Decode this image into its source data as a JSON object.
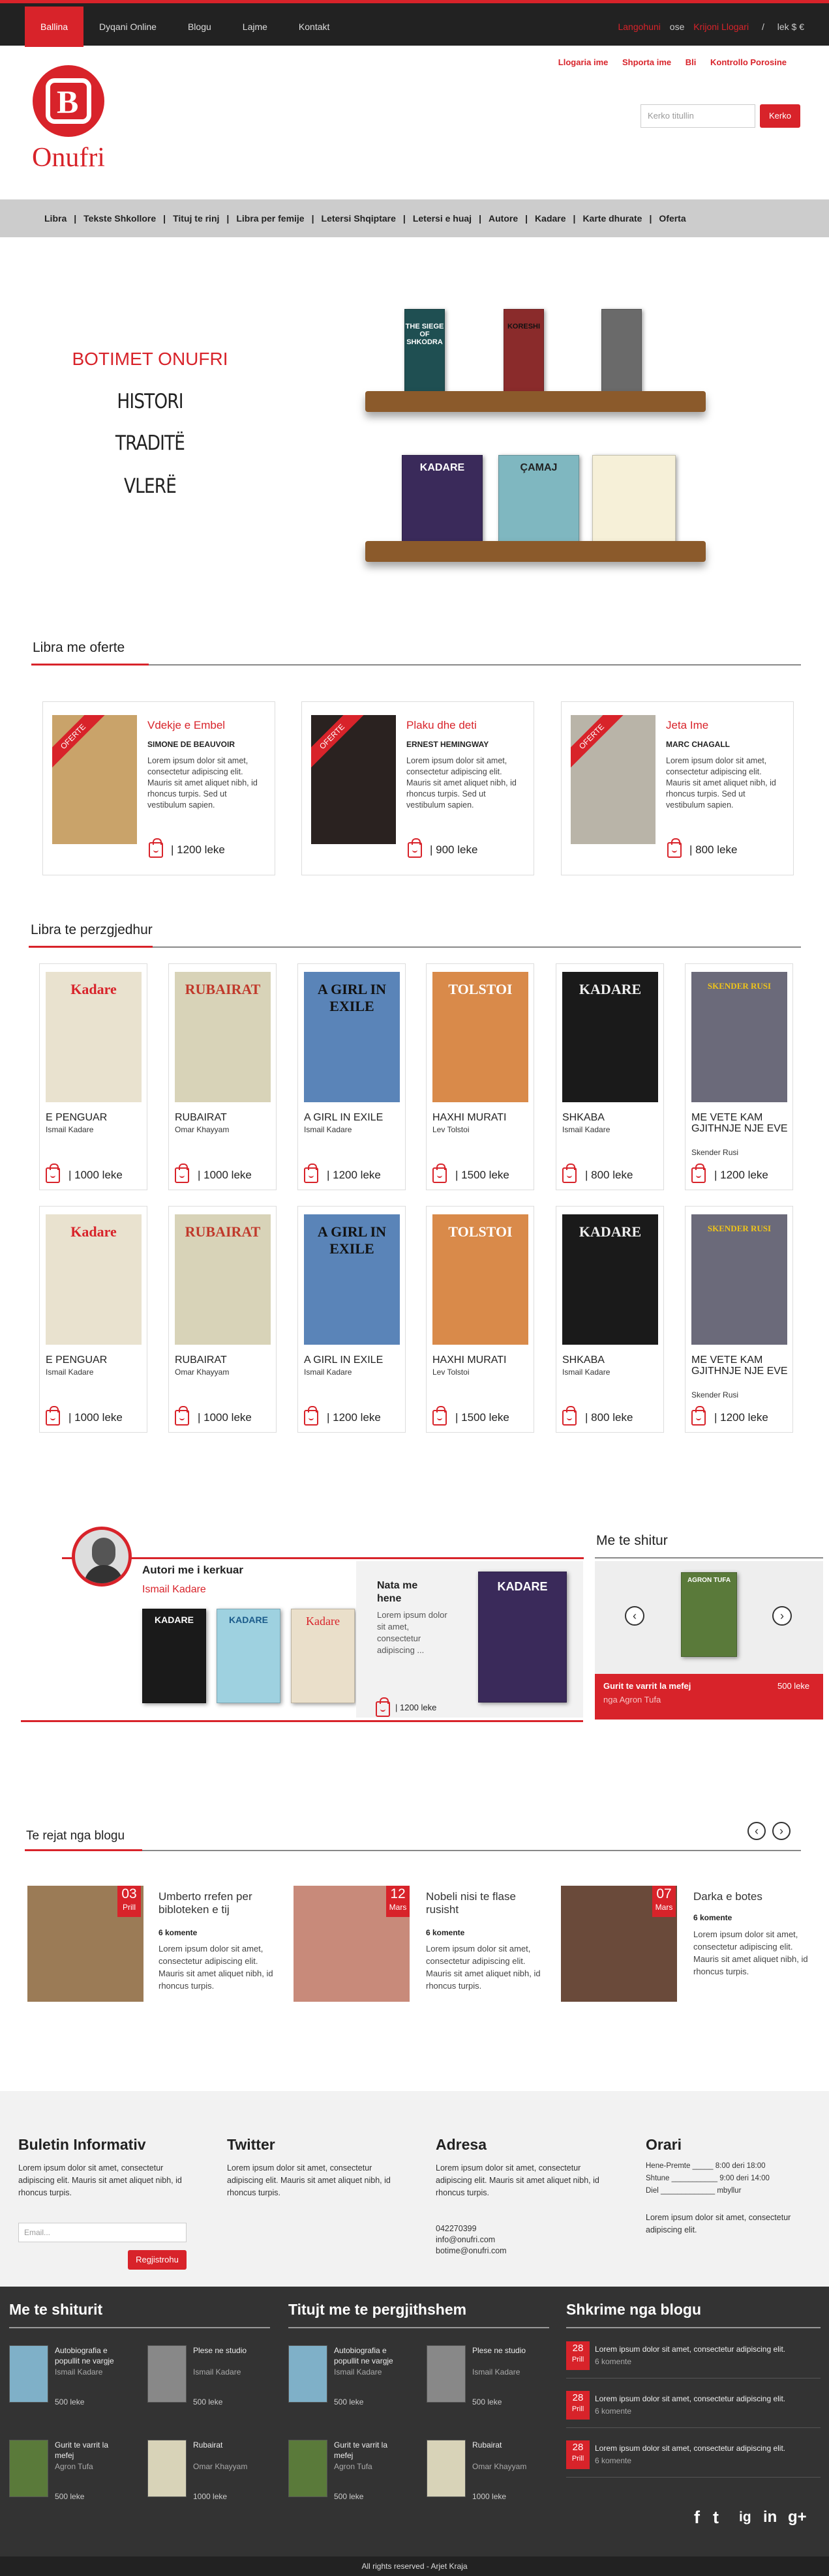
{
  "topbar": {
    "nav": [
      "Ballina",
      "Dyqani Online",
      "Blogu",
      "Lajme",
      "Kontakt"
    ],
    "login": "Langohuni",
    "or": "ose",
    "register": "Krijoni Llogari",
    "sep": "/",
    "currency": "lek $ €"
  },
  "header": {
    "logo_text": "Onufri",
    "account_links": [
      "Llogaria ime",
      "Shporta ime",
      "Bli",
      "Kontrollo Porosine"
    ],
    "search_placeholder": "Kerko titullin",
    "search_button": "Kerko"
  },
  "categories": [
    "Libra",
    "Tekste Shkollore",
    "Tituj te rinj",
    "Libra per femije",
    "Letersi Shqiptare",
    "Letersi e huaj",
    "Autore",
    "Kadare",
    "Karte dhurate",
    "Oferta"
  ],
  "hero": {
    "title": "BOTIMET ONUFRI",
    "words": [
      "HISTORI",
      "TRADITË",
      "VLERË"
    ],
    "books": [
      "THE SIEGE OF SHKODRA",
      "KORESHI",
      "",
      "KADARE",
      "ÇAMAJ",
      ""
    ]
  },
  "offers": {
    "heading": "Libra me oferte",
    "ribbon": "OFERTE",
    "items": [
      {
        "title": "Vdekje e Embel",
        "author": "SIMONE DE BEAUVOIR",
        "desc": "Lorem ipsum dolor sit amet, consectetur adipiscing elit. Mauris sit amet aliquet nibh, id rhoncus turpis. Sed ut vestibulum sapien.",
        "price": "| 1200 leke",
        "cover": "#c9a36a"
      },
      {
        "title": "Plaku dhe deti",
        "author": "ERNEST HEMINGWAY",
        "desc": "Lorem ipsum dolor sit amet, consectetur adipiscing elit. Mauris sit amet aliquet nibh, id rhoncus turpis. Sed ut vestibulum sapien.",
        "price": "| 900 leke",
        "cover": "#2a2220"
      },
      {
        "title": "Jeta Ime",
        "author": "MARC CHAGALL",
        "desc": "Lorem ipsum dolor sit amet, consectetur adipiscing elit. Mauris sit amet aliquet nibh, id rhoncus turpis. Sed ut vestibulum sapien.",
        "price": "| 800 leke",
        "cover": "#b9b4a8"
      }
    ]
  },
  "featured": {
    "heading": "Libra te perzgjedhur",
    "items": [
      {
        "title": "E PENGUAR",
        "author": "Ismail Kadare",
        "price": "| 1000 leke",
        "cover_label": "Kadare",
        "bg": "#e9e2cf",
        "fg": "#d8232a"
      },
      {
        "title": "RUBAIRAT",
        "author": "Omar Khayyam",
        "price": "| 1000 leke",
        "cover_label": "RUBAIRAT",
        "bg": "#d8d3b8",
        "fg": "#c0392b"
      },
      {
        "title": "A GIRL IN EXILE",
        "author": "Ismail Kadare",
        "price": "| 1200 leke",
        "cover_label": "A GIRL IN EXILE",
        "bg": "#5a84b8",
        "fg": "#111"
      },
      {
        "title": "HAXHI MURATI",
        "author": "Lev Tolstoi",
        "price": "| 1500 leke",
        "cover_label": "TOLSTOI",
        "bg": "#d98a4a",
        "fg": "#fff"
      },
      {
        "title": "SHKABA",
        "author": "Ismail Kadare",
        "price": "| 800 leke",
        "cover_label": "KADARE",
        "bg": "#1a1a1a",
        "fg": "#eee"
      },
      {
        "title": "ME VETE KAM GJITHNJE NJE EVE",
        "author": "Skender Rusi",
        "price": "| 1200 leke",
        "cover_label": "SKENDER RUSI",
        "bg": "#6b6a7a",
        "fg": "#f0c419"
      }
    ]
  },
  "author_section": {
    "heading": "Autori me i kerkuar",
    "name": "Ismail Kadare",
    "books": [
      "KADARE",
      "KADARE",
      "Kadare"
    ],
    "feature_title": "Nata me hene",
    "feature_desc": "Lorem ipsum dolor sit amet, consectetur adipiscing ...",
    "feature_price": "| 1200 leke",
    "feature_cover": "KADARE"
  },
  "popular": {
    "heading": "Me te shitur",
    "book_title": "Gurit te varrit la mefej",
    "author": "nga Agron Tufa",
    "price": "500 leke",
    "cover_label": "AGRON TUFA"
  },
  "blog": {
    "heading": "Te rejat nga blogu",
    "posts": [
      {
        "day": "03",
        "month": "Prill",
        "title": "Umberto rrefen per bibloteken e tij",
        "comments": "6 komente",
        "desc": "Lorem ipsum dolor sit amet, consectetur adipiscing elit. Mauris sit amet aliquet nibh, id rhoncus turpis."
      },
      {
        "day": "12",
        "month": "Mars",
        "title": "Nobeli nisi te flase rusisht",
        "comments": "6 komente",
        "desc": "Lorem ipsum dolor sit amet, consectetur adipiscing elit. Mauris sit amet aliquet nibh, id rhoncus turpis."
      },
      {
        "day": "07",
        "month": "Mars",
        "title": "Darka e botes",
        "comments": "6 komente",
        "desc": "Lorem ipsum dolor sit amet, consectetur adipiscing elit. Mauris sit amet aliquet nibh, id rhoncus turpis."
      }
    ]
  },
  "footer": {
    "newsletter": {
      "title": "Buletin Informativ",
      "text": "Lorem ipsum dolor sit amet, consectetur adipiscing elit. Mauris sit amet aliquet nibh, id rhoncus turpis.",
      "placeholder": "Email...",
      "button": "Regjistrohu"
    },
    "twitter": {
      "title": "Twitter",
      "text": "Lorem ipsum dolor sit amet, consectetur adipiscing elit. Mauris sit amet aliquet nibh, id rhoncus turpis."
    },
    "address": {
      "title": "Adresa",
      "text": "Lorem ipsum dolor sit amet, consectetur adipiscing elit. Mauris sit amet aliquet nibh, id rhoncus turpis.",
      "phone": "042270399",
      "email1": "info@onufri.com",
      "email2": "botime@onufri.com"
    },
    "hours": {
      "title": "Orari",
      "rows": [
        "Hene-Premte _____ 8:00 deri 18:00",
        "Shtune ___________ 9:00 deri 14:00",
        "Diel _____________ mbyllur"
      ],
      "text": "Lorem ipsum dolor sit amet, consectetur adipiscing elit."
    },
    "bestsellers": {
      "title": "Me te shiturit"
    },
    "new_titles": {
      "title": "Titujt me te pergjithshem"
    },
    "blog_subs": {
      "title": "Shkrime nga blogu"
    },
    "mini_books": [
      {
        "title": "Autobiografia e popullit ne vargje",
        "author": "Ismail Kadare",
        "price": "500 leke",
        "bg": "#7fb0c8"
      },
      {
        "title": "Plese ne studio",
        "author": "Ismail Kadare",
        "price": "500 leke",
        "bg": "#888"
      },
      {
        "title": "Gurit te varrit la mefej",
        "author": "Agron Tufa",
        "price": "500 leke",
        "bg": "#5a7a3a"
      },
      {
        "title": "Rubairat",
        "author": "Omar Khayyam",
        "price": "1000 leke",
        "bg": "#d8d3b8"
      }
    ],
    "blog_items": [
      {
        "day": "28",
        "month": "Prill",
        "text": "Lorem ipsum dolor sit amet, consectetur adipiscing elit.",
        "comments": "6 komente"
      },
      {
        "day": "28",
        "month": "Prill",
        "text": "Lorem ipsum dolor sit amet, consectetur adipiscing elit.",
        "comments": "6 komente"
      },
      {
        "day": "28",
        "month": "Prill",
        "text": "Lorem ipsum dolor sit amet, consectetur adipiscing elit.",
        "comments": "6 komente"
      }
    ],
    "social": [
      "f",
      "t",
      "ig",
      "in",
      "g+"
    ],
    "copyright": "All rights reserved - Arjet Kraja"
  },
  "colors": {
    "accent": "#d8232a",
    "dark": "#333333",
    "topbar": "#222222"
  }
}
